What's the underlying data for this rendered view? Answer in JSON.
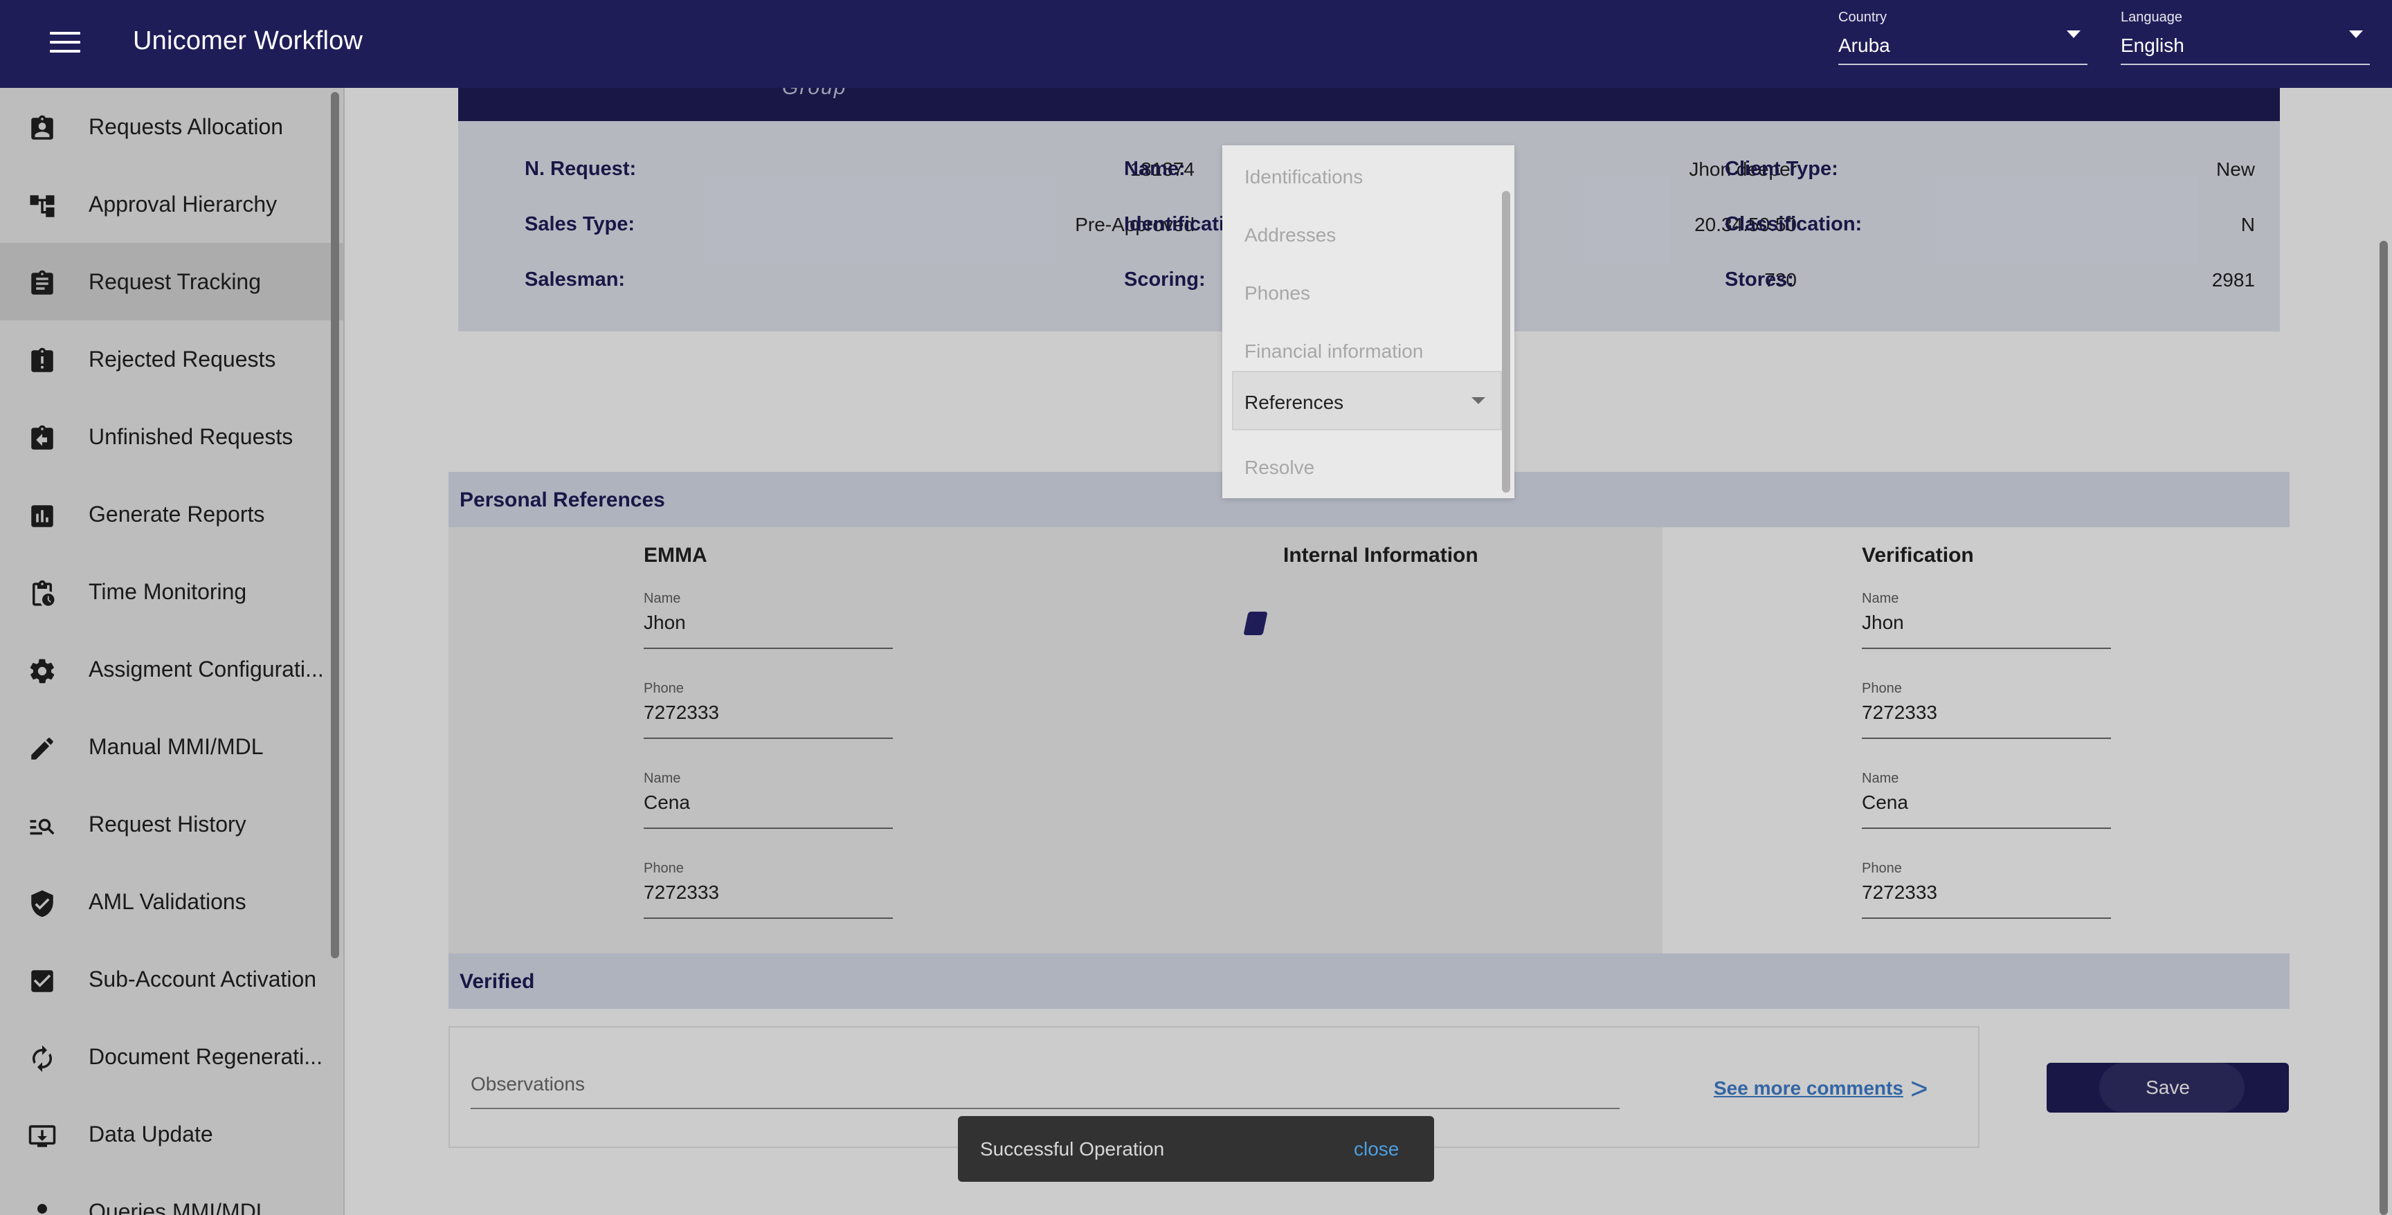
{
  "app": {
    "title": "Unicomer Workflow"
  },
  "header": {
    "country": {
      "label": "Country",
      "value": "Aruba"
    },
    "language": {
      "label": "Language",
      "value": "English"
    }
  },
  "sidebar": {
    "items": [
      {
        "label": "Requests Allocation",
        "icon": "assignment-ind-icon"
      },
      {
        "label": "Approval Hierarchy",
        "icon": "account-tree-icon"
      },
      {
        "label": "Request Tracking",
        "icon": "assignment-icon"
      },
      {
        "label": "Rejected Requests",
        "icon": "assignment-late-icon"
      },
      {
        "label": "Unfinished Requests",
        "icon": "assignment-return-icon"
      },
      {
        "label": "Generate Reports",
        "icon": "assessment-icon"
      },
      {
        "label": "Time Monitoring",
        "icon": "pending-actions-icon"
      },
      {
        "label": "Assigment Configurati...",
        "icon": "settings-icon"
      },
      {
        "label": "Manual MMI/MDL",
        "icon": "edit-icon"
      },
      {
        "label": "Request History",
        "icon": "manage-search-icon"
      },
      {
        "label": "AML Validations",
        "icon": "verified-user-icon"
      },
      {
        "label": "Sub-Account Activation",
        "icon": "check-box-icon"
      },
      {
        "label": "Document Regenerati...",
        "icon": "autorenew-icon"
      },
      {
        "label": "Data Update",
        "icon": "system-update-icon"
      },
      {
        "label": "Queries MMI/MDL",
        "icon": "person-icon"
      }
    ],
    "active_index": 2
  },
  "request_header": {
    "group_text": "Group"
  },
  "info": {
    "n_request": {
      "label": "N. Request:",
      "value": "181374"
    },
    "sales_type": {
      "label": "Sales Type:",
      "value": "Pre-Approved"
    },
    "salesman": {
      "label": "Salesman:",
      "value": ""
    },
    "name": {
      "label": "Name:",
      "value": "Jhon deeper"
    },
    "identification_number": {
      "label": "Identification Number:",
      "value": "20.34.50.50"
    },
    "scoring": {
      "label": "Scoring:",
      "value": "730"
    },
    "client_type": {
      "label": "Client Type:",
      "value": "New"
    },
    "classification": {
      "label": "Classification:",
      "value": "N"
    },
    "stores": {
      "label": "Stores:",
      "value": "2981"
    }
  },
  "section_menu": {
    "items": [
      "Identifications",
      "Addresses",
      "Phones",
      "Financial information",
      "Resolve"
    ],
    "selected": "References"
  },
  "personal_references": {
    "title": "Personal References",
    "left_column": {
      "title": "EMMA",
      "fields": [
        {
          "label": "Name",
          "value": "Jhon"
        },
        {
          "label": "Phone",
          "value": "7272333"
        },
        {
          "label": "Name",
          "value": "Cena"
        },
        {
          "label": "Phone",
          "value": "7272333"
        }
      ]
    },
    "middle_column": {
      "title": "Internal Information"
    },
    "right_column": {
      "title": "Verification",
      "fields": [
        {
          "label": "Name",
          "value": "Jhon"
        },
        {
          "label": "Phone",
          "value": "7272333"
        },
        {
          "label": "Name",
          "value": "Cena"
        },
        {
          "label": "Phone",
          "value": "7272333"
        }
      ]
    }
  },
  "verified": {
    "title": "Verified"
  },
  "observations": {
    "placeholder": "Observations",
    "see_more": "See more comments",
    "see_more_arrow": ">"
  },
  "actions": {
    "save": "Save"
  },
  "snackbar": {
    "message": "Successful Operation",
    "close": "close"
  }
}
